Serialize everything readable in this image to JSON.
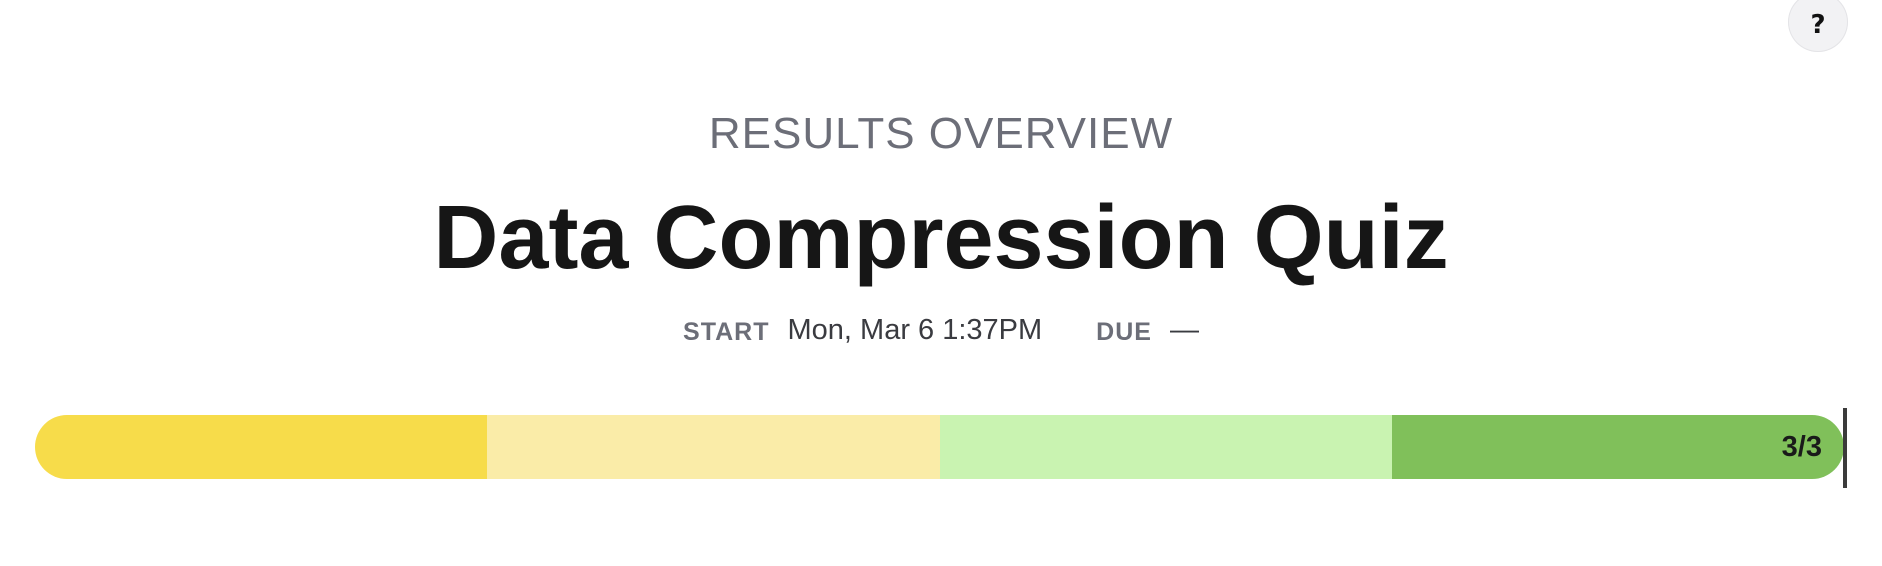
{
  "help": {
    "label": "?",
    "icon": "help-icon"
  },
  "header": {
    "eyebrow": "RESULTS OVERVIEW",
    "title": "Data Compression Quiz"
  },
  "meta": {
    "start_label": "START",
    "start_value": "Mon, Mar 6 1:37PM",
    "due_label": "DUE",
    "due_value": "—"
  },
  "progress": {
    "score_text": "3/3",
    "score": 3,
    "total": 3,
    "segments": [
      {
        "name": "segment-1",
        "color": "#f7dc4a"
      },
      {
        "name": "segment-2",
        "color": "#faeca8"
      },
      {
        "name": "segment-3",
        "color": "#c9f3b1"
      },
      {
        "name": "segment-4",
        "color": "#80c05a"
      }
    ]
  }
}
